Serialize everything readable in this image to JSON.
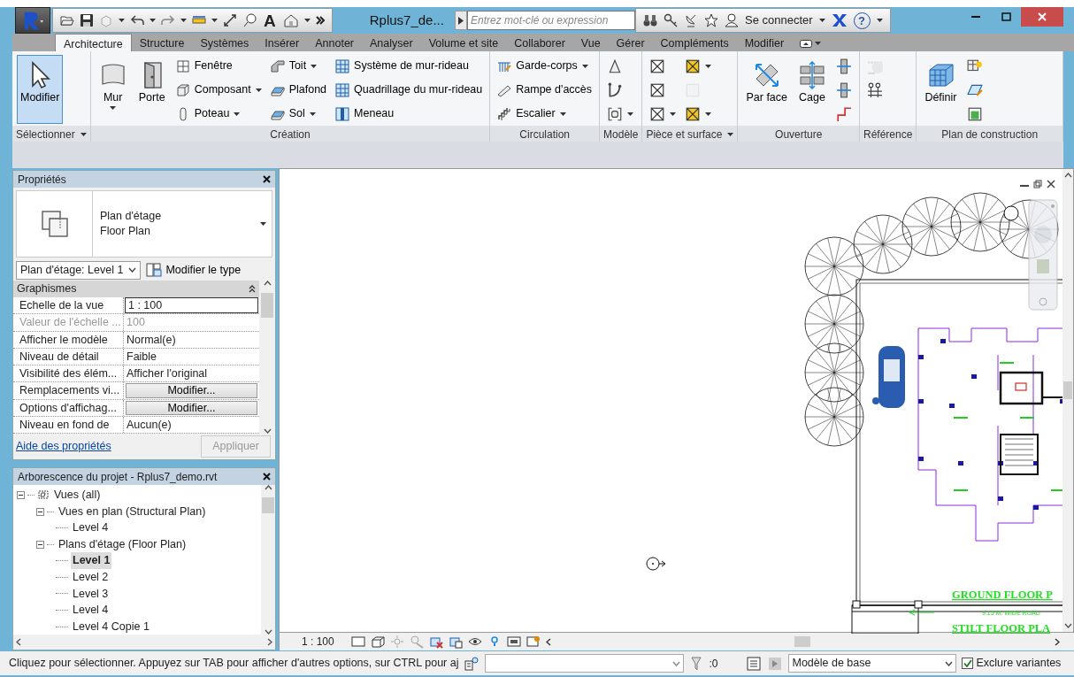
{
  "title_bar": {
    "text_tool": "A",
    "title": "Rplus7_de...",
    "search": {
      "placeholder": "Entrez mot-clé ou expression"
    },
    "sign_in": "Se connecter",
    "help": "?"
  },
  "tabs": [
    {
      "label": "Architecture",
      "selected": true
    },
    {
      "label": "Structure",
      "selected": false
    },
    {
      "label": "Systèmes",
      "selected": false
    },
    {
      "label": "Insérer",
      "selected": false
    },
    {
      "label": "Annoter",
      "selected": false
    },
    {
      "label": "Analyser",
      "selected": false
    },
    {
      "label": "Volume et site",
      "selected": false
    },
    {
      "label": "Collaborer",
      "selected": false
    },
    {
      "label": "Vue",
      "selected": false
    },
    {
      "label": "Gérer",
      "selected": false
    },
    {
      "label": "Compléments",
      "selected": false
    },
    {
      "label": "Modifier",
      "selected": false
    }
  ],
  "ribbon": {
    "panels": [
      {
        "label": "Sélectionner",
        "dropdown": true,
        "columns": [
          [
            {
              "kind": "large",
              "label": "Modifier",
              "active": true,
              "disabled": false,
              "dropdown": false
            }
          ]
        ]
      },
      {
        "label": "Création",
        "dropdown": false,
        "columns": [
          [
            {
              "kind": "large",
              "label": "Mur",
              "active": false,
              "disabled": false,
              "dropdown": true
            }
          ],
          [
            {
              "kind": "large",
              "label": "Porte",
              "active": false,
              "disabled": false,
              "dropdown": false
            }
          ],
          [
            {
              "kind": "small",
              "label": "Fenêtre",
              "active": false,
              "disabled": false,
              "dropdown": false
            },
            {
              "kind": "small",
              "label": "Composant",
              "active": false,
              "disabled": false,
              "dropdown": true
            },
            {
              "kind": "small",
              "label": "Poteau",
              "active": false,
              "disabled": false,
              "dropdown": true
            }
          ],
          [
            {
              "kind": "small",
              "label": "Toit",
              "active": false,
              "disabled": false,
              "dropdown": true
            },
            {
              "kind": "small",
              "label": "Plafond",
              "active": false,
              "disabled": false,
              "dropdown": false
            },
            {
              "kind": "small",
              "label": "Sol",
              "active": false,
              "disabled": false,
              "dropdown": true
            }
          ],
          [
            {
              "kind": "small",
              "label": "Système de mur-rideau",
              "active": false,
              "disabled": false,
              "dropdown": false
            },
            {
              "kind": "small",
              "label": "Quadrillage du mur-rideau",
              "active": false,
              "disabled": false,
              "dropdown": false
            },
            {
              "kind": "small",
              "label": "Meneau",
              "active": false,
              "disabled": false,
              "dropdown": false
            }
          ]
        ]
      },
      {
        "label": "Circulation",
        "dropdown": false,
        "columns": [
          [
            {
              "kind": "small",
              "label": "Garde-corps",
              "active": false,
              "disabled": false,
              "dropdown": true
            },
            {
              "kind": "small",
              "label": "Rampe d'accès",
              "active": false,
              "disabled": false,
              "dropdown": false
            },
            {
              "kind": "small",
              "label": "Escalier",
              "active": false,
              "disabled": false,
              "dropdown": true
            }
          ]
        ]
      },
      {
        "label": "Modèle",
        "dropdown": false,
        "columns": [
          [
            {
              "kind": "icon",
              "active": false,
              "disabled": false,
              "dropdown": false
            },
            {
              "kind": "icon",
              "active": false,
              "disabled": false,
              "dropdown": false
            },
            {
              "kind": "icon",
              "active": false,
              "disabled": false,
              "dropdown": true
            }
          ]
        ]
      },
      {
        "label": "Pièce et surface",
        "dropdown": true,
        "columns": [
          [
            {
              "kind": "icon",
              "active": false,
              "disabled": false,
              "dropdown": false
            },
            {
              "kind": "icon",
              "active": false,
              "disabled": false,
              "dropdown": false
            },
            {
              "kind": "icon",
              "active": false,
              "disabled": false,
              "dropdown": true
            }
          ],
          [
            {
              "kind": "icon",
              "active": false,
              "disabled": false,
              "dropdown": true
            },
            {
              "kind": "icon",
              "active": false,
              "disabled": true,
              "dropdown": false
            },
            {
              "kind": "icon",
              "active": false,
              "disabled": false,
              "dropdown": true
            }
          ]
        ]
      },
      {
        "label": "Ouverture",
        "dropdown": false,
        "columns": [
          [
            {
              "kind": "large",
              "label": "Par face",
              "active": false,
              "disabled": false,
              "dropdown": false
            }
          ],
          [
            {
              "kind": "large",
              "label": "Cage",
              "active": false,
              "disabled": false,
              "dropdown": false
            }
          ],
          [
            {
              "kind": "icon",
              "active": false,
              "disabled": false,
              "dropdown": false
            },
            {
              "kind": "icon",
              "active": false,
              "disabled": false,
              "dropdown": false
            },
            {
              "kind": "icon",
              "active": false,
              "disabled": false,
              "dropdown": false
            }
          ]
        ]
      },
      {
        "label": "Référence",
        "dropdown": false,
        "columns": [
          [
            {
              "kind": "icon",
              "active": false,
              "disabled": true,
              "dropdown": false
            },
            {
              "kind": "icon",
              "active": false,
              "disabled": false,
              "dropdown": false
            }
          ]
        ]
      },
      {
        "label": "Plan de construction",
        "dropdown": false,
        "columns": [
          [
            {
              "kind": "large",
              "label": "Définir",
              "active": false,
              "disabled": false,
              "dropdown": false
            }
          ],
          [
            {
              "kind": "icon",
              "active": false,
              "disabled": false,
              "dropdown": false
            },
            {
              "kind": "icon",
              "active": false,
              "disabled": false,
              "dropdown": false
            },
            {
              "kind": "icon",
              "active": false,
              "disabled": false,
              "dropdown": false
            }
          ]
        ]
      }
    ]
  },
  "properties": {
    "title": "Propriétés",
    "type_name": "Plan d'étage",
    "type_sub": "Floor Plan",
    "instance": "Plan d'étage: Level 1",
    "edit_type": "Modifier le type",
    "group": "Graphismes",
    "rows": [
      {
        "name": "Echelle de la vue",
        "value": "1 : 100",
        "kind": "input",
        "disabled": false
      },
      {
        "name": "Valeur de l'échelle ...",
        "value": "100",
        "kind": "text",
        "disabled": true
      },
      {
        "name": "Afficher le modèle",
        "value": "Normal(e)",
        "kind": "text",
        "disabled": false
      },
      {
        "name": "Niveau de détail",
        "value": "Faible",
        "kind": "text",
        "disabled": false
      },
      {
        "name": "Visibilité des élém...",
        "value": "Afficher l'original",
        "kind": "text",
        "disabled": false
      },
      {
        "name": "Remplacements vi...",
        "value": "Modifier...",
        "kind": "button",
        "disabled": false
      },
      {
        "name": "Options d'affichag...",
        "value": "Modifier...",
        "kind": "button",
        "disabled": false
      },
      {
        "name": "Niveau en fond de",
        "value": "Aucun(e)",
        "kind": "text",
        "disabled": false
      }
    ],
    "help_link": "Aide des propriétés",
    "apply": {
      "label": "Appliquer",
      "disabled": true
    }
  },
  "project_browser": {
    "title": "Arborescence du projet - Rplus7_demo.rvt",
    "tree": [
      {
        "label": "Vues (all)",
        "expanded": true,
        "selected": false,
        "children": [
          {
            "label": "Vues en plan (Structural Plan)",
            "expanded": true,
            "selected": false,
            "children": [
              {
                "label": "Level 4",
                "selected": false
              }
            ]
          },
          {
            "label": "Plans d'étage (Floor Plan)",
            "expanded": true,
            "selected": false,
            "children": [
              {
                "label": "Level 1",
                "selected": true
              },
              {
                "label": "Level 2",
                "selected": false
              },
              {
                "label": "Level 3",
                "selected": false
              },
              {
                "label": "Level 4",
                "selected": false
              },
              {
                "label": "Level 4 Copie 1",
                "selected": false
              }
            ]
          }
        ]
      }
    ]
  },
  "drawing": {
    "labels": [
      {
        "kind": "title",
        "text": "GROUND FLOOR P"
      },
      {
        "kind": "note",
        "text": "9.15 M. WIDE ROAD"
      },
      {
        "kind": "title",
        "text": "STILT FLOOR PLA"
      }
    ]
  },
  "view_bar": {
    "scale": "1 : 100"
  },
  "status_bar": {
    "message": "Cliquez pour sélectionner. Appuyez sur TAB pour afficher d'autres options, sur CTRL pour aj",
    "filter_count": ":0",
    "workset": "Modèle de base",
    "exclude_options": {
      "label": "Exclure variantes",
      "checked": true
    }
  }
}
